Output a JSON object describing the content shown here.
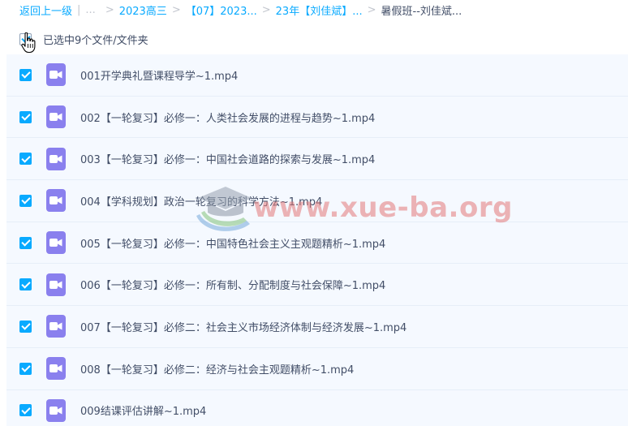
{
  "breadcrumb": {
    "back": "返回上一级",
    "sep1": "|",
    "ellipsis": "...",
    "sep": ">",
    "items": [
      "2023高三",
      "【07】2023...",
      "23年【刘佳斌】..."
    ],
    "current": "暑假班--刘佳斌..."
  },
  "selection": {
    "label": "已选中9个文件/文件夹"
  },
  "files": [
    {
      "name": "001开学典礼暨课程导学~1.mp4"
    },
    {
      "name": "002【一轮复习】必修一：人类社会发展的进程与趋势~1.mp4"
    },
    {
      "name": "003【一轮复习】必修一：中国社会道路的探索与发展~1.mp4"
    },
    {
      "name": "004【学科规划】政治一轮复习的科学方法~1.mp4"
    },
    {
      "name": "005【一轮复习】必修一：中国特色社会主义主观题精析~1.mp4"
    },
    {
      "name": "006【一轮复习】必修一：所有制、分配制度与社会保障~1.mp4"
    },
    {
      "name": "007【一轮复习】必修二：社会主义市场经济体制与经济发展~1.mp4"
    },
    {
      "name": "008【一轮复习】必修二：经济与社会主观题精析~1.mp4"
    },
    {
      "name": "009结课评估讲解~1.mp4"
    }
  ],
  "watermark": {
    "text": "www.xue-ba.org"
  },
  "colors": {
    "accent": "#09aaff",
    "row_bg": "#f5f9ff",
    "video_icon": "#8a80ee",
    "text": "#424e67"
  },
  "icons": {
    "file": "video-file-icon",
    "checkbox": "checkbox-checked-icon",
    "cursor": "hand-pointer-icon",
    "watermark_logo": "graduation-cap-logo"
  }
}
